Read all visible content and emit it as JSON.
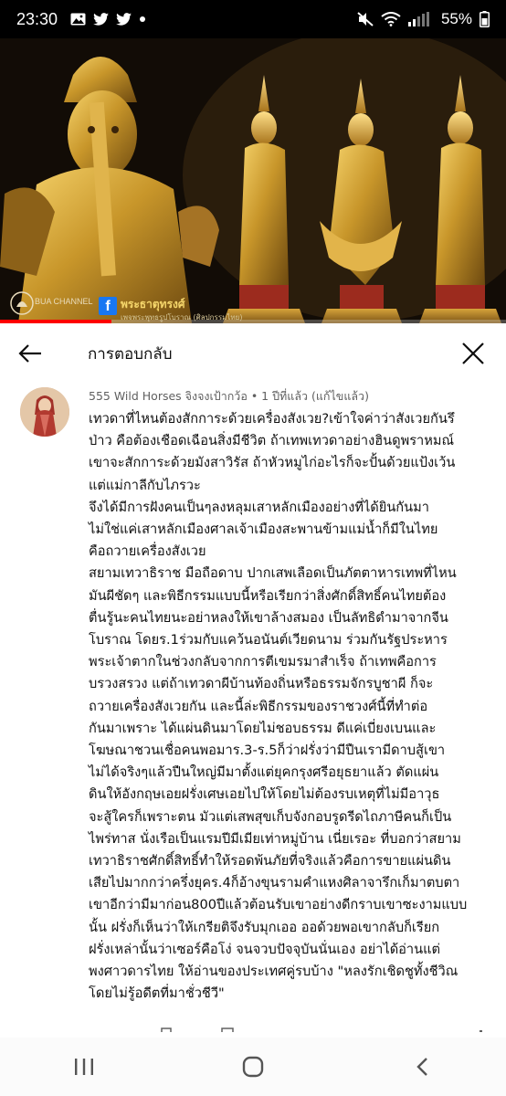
{
  "status_bar": {
    "time": "23:30",
    "battery": "55%",
    "left_icons": [
      "image-icon",
      "twitter-icon",
      "twitter-icon",
      "dot-icon"
    ],
    "right_icons": [
      "mute-icon",
      "wifi-icon",
      "signal-icon",
      "battery-icon"
    ]
  },
  "video": {
    "channel": "BUA CHANNEL",
    "facebook_page": "พระธาตุทรงศ์",
    "facebook_sub": "เพจพระพุทธรูปโบราณ (ศิลปกรรมไทย)",
    "progress": 0.22,
    "accent": "#ff0000"
  },
  "replies_header": {
    "title": "การตอบกลับ",
    "back_icon": "arrow-back-icon",
    "close_icon": "close-icon"
  },
  "comment": {
    "author": "555 Wild Horses จิงจงเป้ากว้อ",
    "time": "1 ปีที่แล้ว",
    "edited": "(แก้ไขแล้ว)",
    "lines": [
      "เทวดาที่ไหนต้องสักการะด้วยเครื่องสังเวย?เข้าใจค่าว่าสังเวยกันรึ",
      "ป่าว คือต้องเชือดเฉือนสิ่งมีชีวิต ถ้าเทพเทวดาอย่างฮินดูพราหมณ์",
      "เขาจะสักการะด้วยมังสาวิรัส ถ้าหัวหมูไก่อะไรก็จะปั้นด้วยแป้งเว้น",
      "แต่แม่กาลีกับไภรวะ",
      "จึงได้มีการฝังคนเป็นๆลงหลุมเสาหลักเมืองอย่างที่ได้ยินกันมา",
      "ไม่ใช่แค่เสาหลักเมืองศาลเจ้าเมืองสะพานข้ามแม่น้ำก็มีในไทย",
      "คือถวายเครื่องสังเวย",
      "สยามเทวาธิราช มือถือดาบ ปากเสพเลือดเป็นภัตตาหารเทพที่ไหน",
      "มันผีชัดๆ และพิธีกรรมแบบนี้หรือเรียกว่าสิ่งศักดิ์สิทธิ์คนไทยต้อง",
      "ตื่นรู้นะคนไทยนะอย่าหลงให้เขาล้างสมอง เป็นลัทธิดำมาจากจีน",
      "โบราณ โดยร.1ร่วมกับแคว้นอนันต์เวียดนาม ร่วมกันรัฐประหาร",
      "พระเจ้าตากในช่วงกลับจากการตีเขมรมาสำเร็จ ถ้าเทพคือการ",
      "บรวงสรวง แต่ถ้าเทวดาผีบ้านท้องถิ่นหรือธรรมจักรบูชาผี ก็จะ",
      "ถวายเครื่องสังเวยกัน และนี้ล่ะพิธีกรรมของราชวงศ์นี้ที่ทำต่อ",
      "กันมาเพราะ ได้แผ่นดินมาโดยไม่ชอบธรรม ดีแค่เบี่ยงเบนและ",
      "โฆษณาชวนเชื่อคนพอมาร.3-ร.5ก็ว่าฝรั่งว่ามีปืนเรามีดาบสู้เขา",
      "ไม่ได้จริงๆแล้วปืนใหญ่มีมาตั้งแต่ยุคกรุงศรีอยุธยาแล้ว ตัดแผ่น",
      "ดินให้อังกฤษเอยฝรั่งเศษเอยไปให้โดยไม่ต้องรบเหตุที่ไม่มีอาวุธ",
      "จะสู้ใครก็เพราะตน มัวแต่เสพสุขเก็บจังกอบรูดรีดไถภาษีคนก็เป็น",
      "ไพร่ทาส นั่งเรือเป็นแรมปีมีเมียเท่าหมู่บ้าน เนี่ยเรอะ ที่บอกว่าสยาม",
      "เทวาธิราชศักดิ์สิทธิ์ทำให้รอดพ้นภัยที่จริงแล้วคือการขายแผ่นดิน",
      "เสียไปมากกว่าครึ่งยุคร.4ก็อ้างขุนรามคำแหงศิลาจารึกเก็มาตบตา",
      "เขาอีกว่ามีมาก่อน800ปีแล้วต้อนรับเขาอย่างดีกราบเขาซะงามแบบ",
      "นั้น ฝรั่งก็เห็นว่าให้เกรียติจึงรับมุกเออ ออด้วยพอเขากลับก็เรียก",
      "ฝรั่งเหล่านั้นว่าเซอร์คือโง่ จนจวบปัจจุบันนั่นเอง อย่าได้อ่านแต่",
      "พงศาวดารไทย ให้อ่านของประเทศคู่รบบ้าง \"หลงรักเชิดชูทั้งชีวิณ",
      "โดยไม่รู้อดีตที่มาชั่วชีวี\""
    ]
  },
  "nav_bar": {
    "recents_icon": "recents-icon",
    "home_icon": "home-icon",
    "back_icon": "nav-back-icon"
  }
}
